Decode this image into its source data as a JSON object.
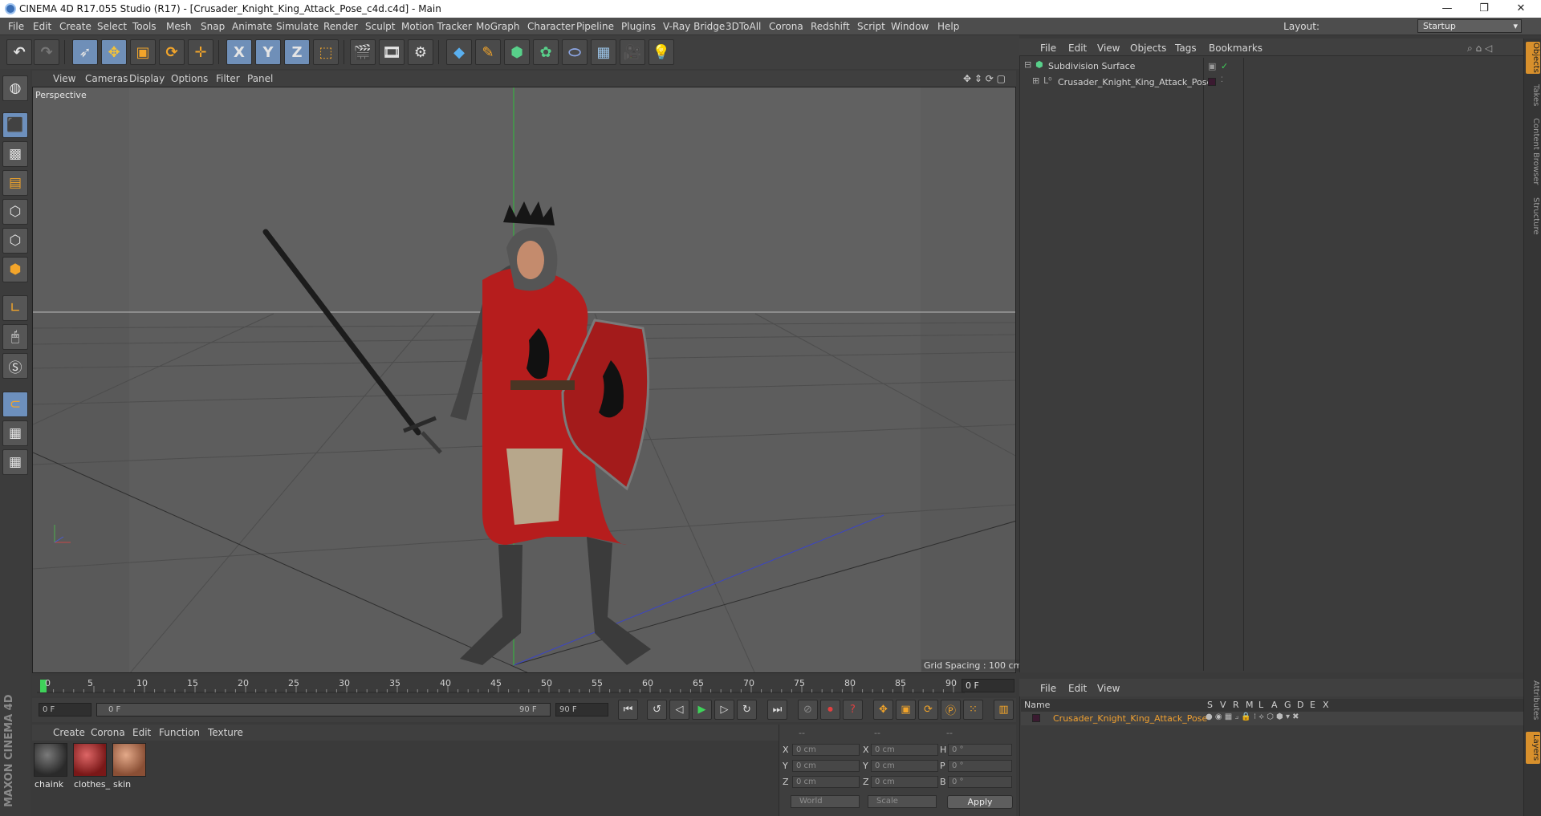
{
  "titlebar": {
    "title": "CINEMA 4D R17.055 Studio (R17) - [Crusader_Knight_King_Attack_Pose_c4d.c4d] - Main",
    "minimize": "—",
    "maximize": "❐",
    "close": "✕"
  },
  "menubar": {
    "items": [
      "File",
      "Edit",
      "Create",
      "Select",
      "Tools",
      "Mesh",
      "Snap",
      "Animate",
      "Simulate",
      "Render",
      "Sculpt",
      "Motion Tracker",
      "MoGraph",
      "Character",
      "Pipeline",
      "Plugins",
      "V-Ray Bridge",
      "3DToAll",
      "Corona",
      "Redshift",
      "Script",
      "Window",
      "Help"
    ],
    "layout_label": "Layout:",
    "layout_value": "Startup"
  },
  "toolbar": {
    "axis_labels": [
      "X",
      "Y",
      "Z"
    ],
    "icons": [
      "undo-icon",
      "redo-icon",
      "select-icon",
      "move-icon",
      "scale-icon",
      "rotate-icon",
      "transform-icon",
      "axis-x-icon",
      "axis-y-icon",
      "axis-z-icon",
      "world-coord-icon",
      "render-view-icon",
      "render-picture-viewer-icon",
      "render-settings-icon",
      "cube-icon",
      "pen-icon",
      "subdivision-icon",
      "mograph-cloner-icon",
      "deformer-icon",
      "floor-icon",
      "camera-icon",
      "light-icon"
    ]
  },
  "viewport": {
    "menus": [
      "View",
      "Cameras",
      "Display",
      "Options",
      "Filter",
      "Panel"
    ],
    "camera_label": "Perspective",
    "grid_spacing": "Grid Spacing : 100 cm"
  },
  "timeline": {
    "ticks": [
      "0",
      "5",
      "10",
      "15",
      "20",
      "25",
      "30",
      "35",
      "40",
      "45",
      "50",
      "55",
      "60",
      "65",
      "70",
      "75",
      "80",
      "85",
      "90"
    ],
    "current_frame": "0 F",
    "start_field": "0 F",
    "range_start": "0 F",
    "range_end": "90 F",
    "end_field": "90 F"
  },
  "materials": {
    "menus": [
      "Create",
      "Corona",
      "Edit",
      "Function",
      "Texture"
    ],
    "items": [
      {
        "label": "chaink",
        "color": "#3a3a3a"
      },
      {
        "label": "clothes_",
        "color": "#9b2a2a"
      },
      {
        "label": "skin",
        "color": "#b9785a"
      }
    ]
  },
  "coordinates": {
    "header": [
      "--",
      "--",
      "--"
    ],
    "rows": [
      {
        "pos_label": "X",
        "pos": "0 cm",
        "size_label": "X",
        "size": "0 cm",
        "rot_label": "H",
        "rot": "0 °"
      },
      {
        "pos_label": "Y",
        "pos": "0 cm",
        "size_label": "Y",
        "size": "0 cm",
        "rot_label": "P",
        "rot": "0 °"
      },
      {
        "pos_label": "Z",
        "pos": "0 cm",
        "size_label": "Z",
        "size": "0 cm",
        "rot_label": "B",
        "rot": "0 °"
      }
    ],
    "space_dropdown": "World",
    "mode_dropdown": "Scale",
    "apply_label": "Apply"
  },
  "object_manager": {
    "menus": [
      "File",
      "Edit",
      "View",
      "Objects",
      "Tags",
      "Bookmarks"
    ],
    "objects": [
      {
        "name": "Subdivision Surface",
        "icon": "subdivision-icon"
      },
      {
        "name": "Crusader_Knight_King_Attack_Pose",
        "icon": "null-object-icon"
      }
    ]
  },
  "layer_manager": {
    "menus": [
      "File",
      "Edit",
      "View"
    ],
    "columns": [
      "Name",
      "S",
      "V",
      "R",
      "M",
      "L",
      "A",
      "G",
      "D",
      "E",
      "X"
    ],
    "layer_name": "Crusader_Knight_King_Attack_Pose",
    "layer_color": "#e8a030"
  },
  "side_tabs": [
    "Objects",
    "Takes",
    "Content Browser",
    "Structure",
    "Attributes",
    "Layers"
  ],
  "branding": "MAXON CINEMA 4D"
}
